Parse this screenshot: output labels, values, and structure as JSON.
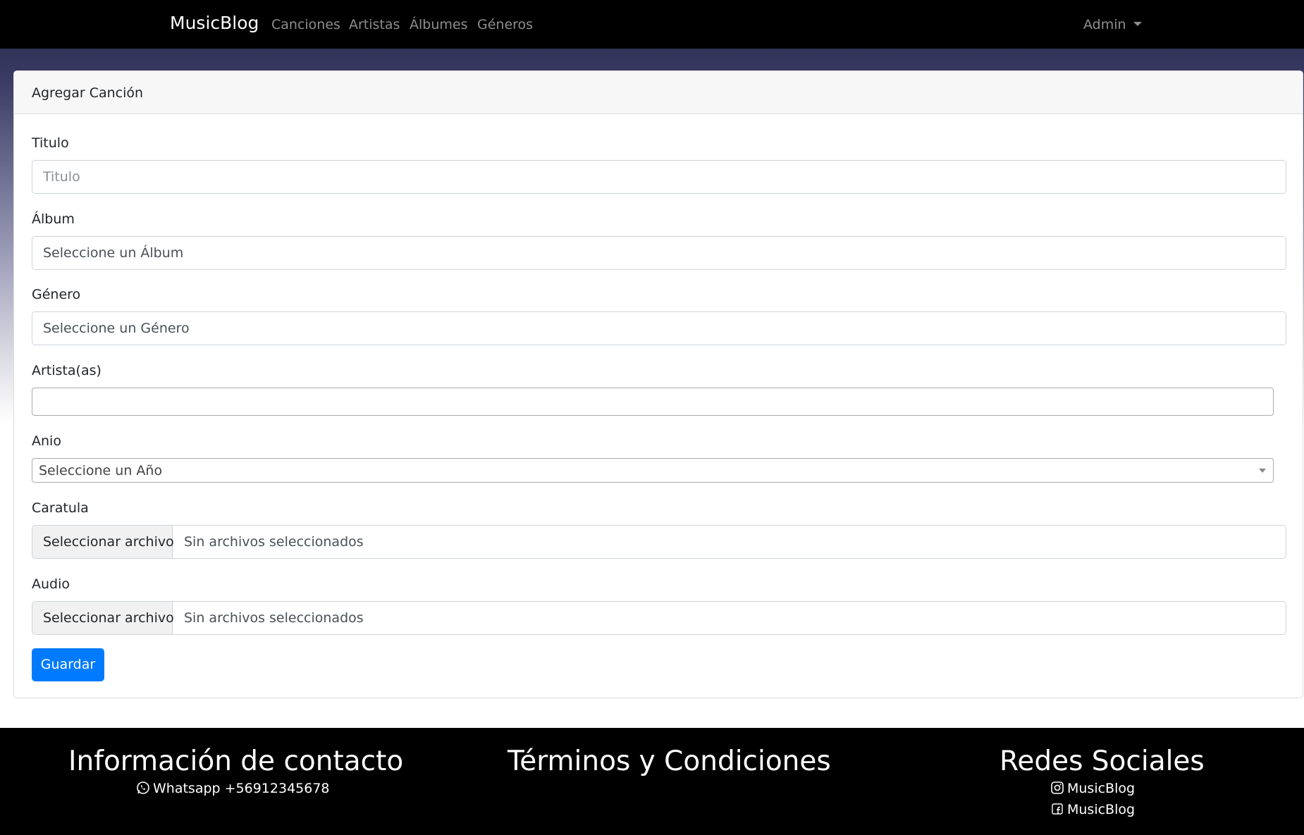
{
  "navbar": {
    "brand": "MusicBlog",
    "links": [
      "Canciones",
      "Artistas",
      "Álbumes",
      "Géneros"
    ],
    "admin": "Admin"
  },
  "form": {
    "header": "Agregar Canción",
    "titulo": {
      "label": "Titulo",
      "placeholder": "Titulo"
    },
    "album": {
      "label": "Álbum",
      "value": "Seleccione un Álbum"
    },
    "genero": {
      "label": "Género",
      "value": "Seleccione un Género"
    },
    "artistas": {
      "label": "Artista(as)",
      "value": ""
    },
    "anio": {
      "label": "Anio",
      "value": "Seleccione un Año"
    },
    "caratula": {
      "label": "Caratula",
      "button": "Seleccionar archivo",
      "status": "Sin archivos seleccionados"
    },
    "audio": {
      "label": "Audio",
      "button": "Seleccionar archivo",
      "status": "Sin archivos seleccionados"
    },
    "save": "Guardar"
  },
  "footer": {
    "contact_heading": "Información de contacto",
    "whatsapp": "Whatsapp +56912345678",
    "terms_heading": "Términos y Condiciones",
    "social_heading": "Redes Sociales",
    "instagram": "MusicBlog",
    "facebook": "MusicBlog"
  }
}
